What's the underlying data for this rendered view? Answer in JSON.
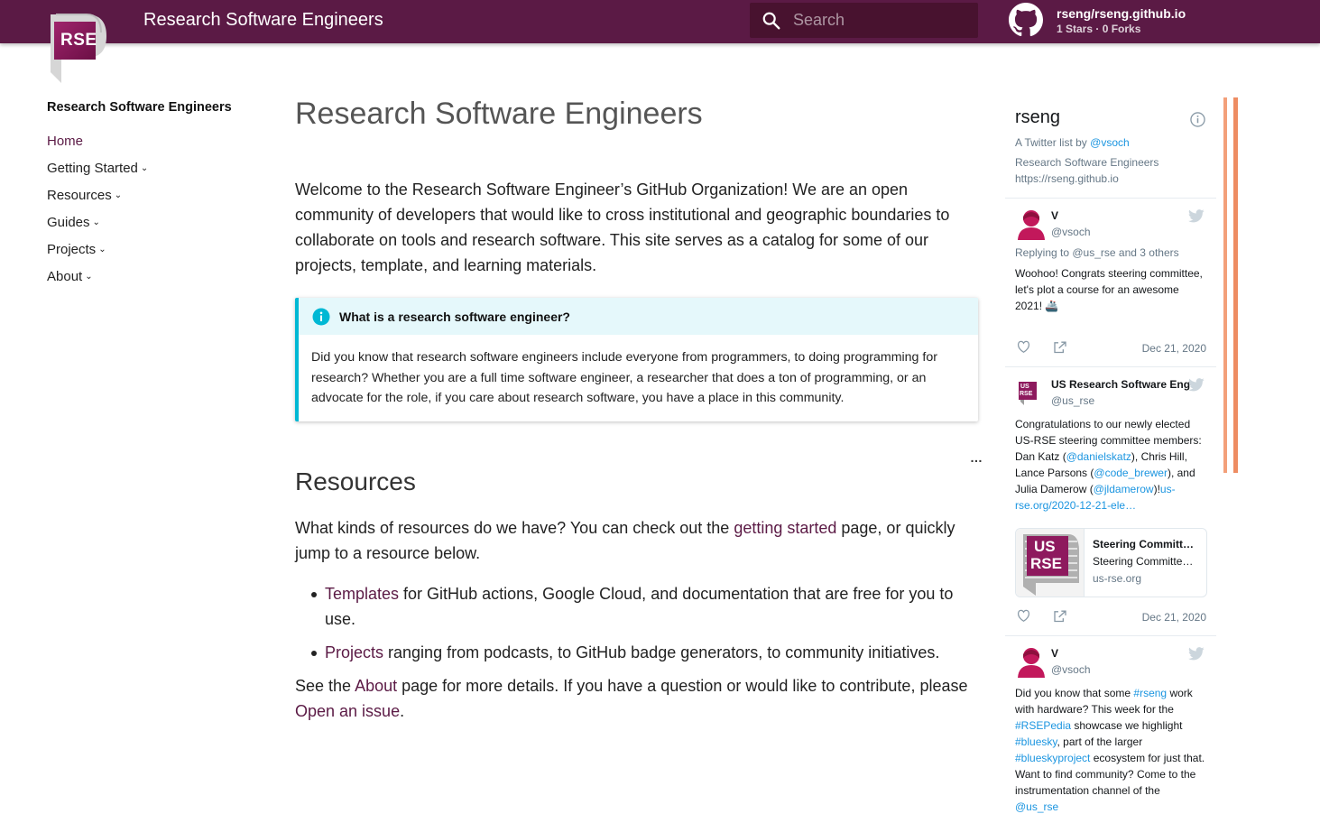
{
  "header": {
    "title": "Research Software Engineers",
    "search_placeholder": "Search",
    "repo_name": "rseng/rseng.github.io",
    "repo_facts": "1 Stars · 0 Forks"
  },
  "logo": {
    "text": "RSE"
  },
  "nav": {
    "title": "Research Software Engineers",
    "items": [
      {
        "label": "Home",
        "has_submenu": false
      },
      {
        "label": "Getting Started",
        "has_submenu": true
      },
      {
        "label": "Resources",
        "has_submenu": true
      },
      {
        "label": "Guides",
        "has_submenu": true
      },
      {
        "label": "Projects",
        "has_submenu": true
      },
      {
        "label": "About",
        "has_submenu": true
      }
    ]
  },
  "main": {
    "title": "Research Software Engineers",
    "intro": "Welcome to the Research Software Engineer’s GitHub Organization! We are an open community of developers that would like to cross institutional and geographic boundaries to collaborate on tools and research software. This site serves as a catalog for some of our projects, template, and learning materials.",
    "admonition": {
      "title": "What is a research software engineer?",
      "body": "Did you know that research software engineers include everyone from programmers, to doing programming for research? Whether you are a full time software engineer, a researcher that does a ton of programming, or an advocate for the role, if you care about research software, you have a place in this community."
    },
    "resources_title": "Resources",
    "resources_intro_before": "What kinds of resources do we have? You can check out the ",
    "resources_link": "getting started",
    "resources_intro_after": " page, or quickly jump to a resource below.",
    "bullets": [
      {
        "link": "Templates",
        "text": " for GitHub actions, Google Cloud, and documentation that are free for you to use."
      },
      {
        "link": "Projects",
        "text": " ranging from podcasts, to GitHub badge generators, to community initiatives."
      }
    ],
    "footer_before": "See the ",
    "footer_about": "About",
    "footer_middle": " page for more details. If you have a question or would like to contribute, please ",
    "footer_issue": "Open an issue",
    "footer_after": "."
  },
  "twitter": {
    "list_name": "rseng",
    "list_by": "A Twitter list by ",
    "list_owner": "@vsoch",
    "list_desc": "Research Software Engineers",
    "list_url": "https://rseng.github.io",
    "tweets": [
      {
        "name": "V",
        "handle": "@vsoch",
        "reply": "Replying to @us_rse and 3 others",
        "text": "Woohoo! Congrats steering committee, let's plot a course for an awesome 2021! 🚢",
        "date": "Dec 21, 2020"
      },
      {
        "name": "US Research Software Eng",
        "handle": "@us_rse",
        "text_a": "Congratulations to our newly elected US-RSE steering committee members: Dan Katz (",
        "link_a": "@danielskatz",
        "text_b": "), Chris Hill, Lance Parsons (",
        "link_b": "@code_brewer",
        "text_c": "), and Julia Damerow (",
        "link_c": "@jldamerow",
        "text_d": ")!",
        "link_d": "us-rse.org/2020-12-21-ele…",
        "card_title": "Steering Committ…",
        "card_desc": "Steering Committe…",
        "card_domain": "us-rse.org",
        "card_logo_top": "US",
        "card_logo_bottom": "RSE",
        "date": "Dec 21, 2020"
      },
      {
        "name": "V",
        "handle": "@vsoch",
        "text_a": "Did you know that some ",
        "link_a": "#rseng",
        "text_b": " work with hardware? This week for the ",
        "link_b": "#RSEPedia",
        "text_c": " showcase we highlight ",
        "link_c": "#bluesky",
        "text_d": ", part of the larger ",
        "link_d": "#blueskyproject",
        "text_e": " ecosystem for just that. Want to find community? Come to the instrumentation channel of the ",
        "link_e": "@us_rse"
      }
    ]
  },
  "colors": {
    "brand": "#5b1a45",
    "admon_accent": "#00b8d4",
    "twitter_link": "#1b95e0"
  }
}
